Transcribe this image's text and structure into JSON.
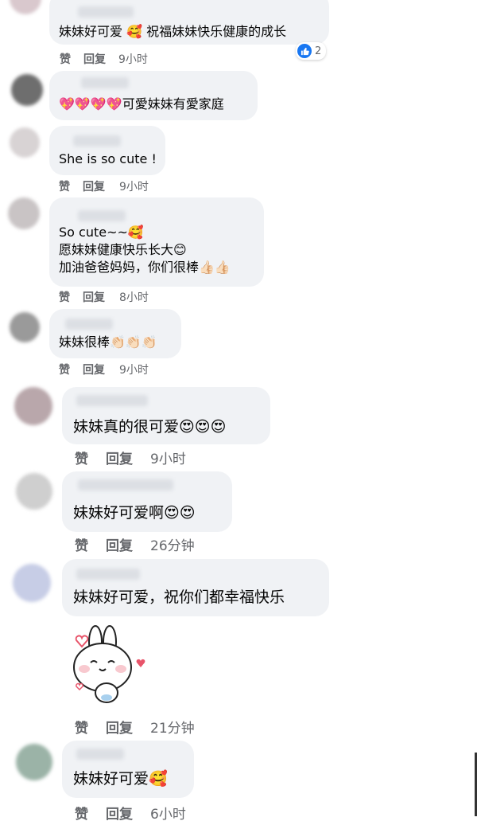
{
  "comments": [
    {
      "text": "妹妹好可爱 🥰 祝福妹妹快乐健康的成长",
      "like": "赞",
      "reply": "回复",
      "time": "9小时",
      "reactions": "2"
    },
    {
      "text": "💖💖💖💖可愛妹妹有愛家庭",
      "like": "",
      "reply": "",
      "time": ""
    },
    {
      "text": "She is so cute !",
      "like": "赞",
      "reply": "回复",
      "time": "9小时"
    },
    {
      "lines": [
        "So cute~~🥰",
        "愿妹妹健康快乐长大😊",
        "加油爸爸妈妈，你们很棒👍🏻👍🏻"
      ],
      "like": "赞",
      "reply": "回复",
      "time": "8小时"
    },
    {
      "text": "妹妹很棒👏🏻👏🏻👏🏻",
      "like": "赞",
      "reply": "回复",
      "time": "9小时"
    },
    {
      "text": "妹妹真的很可爱😍😍😍",
      "like": "赞",
      "reply": "回复",
      "time": "9小时"
    },
    {
      "text": "妹妹好可爱啊😍😍",
      "like": "赞",
      "reply": "回复",
      "time": "26分钟"
    },
    {
      "text": "妹妹好可爱，祝你们都幸福快乐",
      "like": "赞",
      "reply": "回复",
      "time": "21分钟"
    },
    {
      "text": "妹妹好可爱🥰",
      "like": "赞",
      "reply": "回复",
      "time": "6小时"
    }
  ],
  "icons": {
    "reaction": "like-icon",
    "sticker": "bunny-sticker"
  },
  "colors": {
    "bubble": "#f0f2f5",
    "meta": "#65676b",
    "like": "#1877f2"
  }
}
